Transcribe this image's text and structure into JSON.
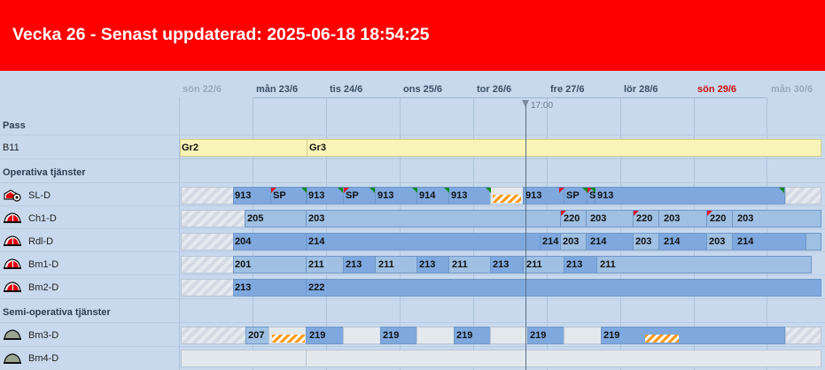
{
  "header": {
    "title": "Vecka 26 - Senast uppdaterad: 2025-06-18 18:54:25",
    "color": "#ff0000"
  },
  "days": [
    "sön 22/6",
    "mån 23/6",
    "tis 24/6",
    "ons 25/6",
    "tor 26/6",
    "fre 27/6",
    "lör 28/6",
    "sön 29/6",
    "mån 30/6"
  ],
  "now_marker": "17:00",
  "sections": {
    "pass": "Pass",
    "operativa": "Operativa tjänster",
    "semi": "Semi-operativa tjänster"
  },
  "rows": {
    "b11": "B11",
    "sl_d": "SL-D",
    "ch1_d": "Ch1-D",
    "rdl_d": "Rdl-D",
    "bm1_d": "Bm1-D",
    "bm2_d": "Bm2-D",
    "bm3_d": "Bm3-D",
    "bm4_d": "Bm4-D"
  },
  "labels": {
    "b11": [
      "Gr2",
      "Gr3"
    ],
    "sl_d": [
      "913",
      "SP",
      "913",
      "SP",
      "913",
      "914",
      "913",
      "913",
      "SP",
      "S",
      "913"
    ],
    "ch1_d": [
      "205",
      "203",
      "220",
      "203",
      "220",
      "203",
      "220",
      "203"
    ],
    "rdl_d": [
      "204",
      "214",
      "214",
      "203",
      "214",
      "203",
      "214",
      "203",
      "214"
    ],
    "bm1_d": [
      "201",
      "211",
      "213",
      "211",
      "213",
      "211",
      "213",
      "211",
      "213",
      "211"
    ],
    "bm2_d": [
      "213",
      "222"
    ],
    "bm3_d": [
      "207",
      "219",
      "219",
      "219",
      "219",
      "219"
    ]
  },
  "icons": {
    "sl_d": "fire-truck-red-icon",
    "ch1_d": "fire-helmet-red-icon",
    "rdl_d": "fire-helmet-red-icon",
    "bm1_d": "fire-helmet-red-icon",
    "bm2_d": "fire-helmet-red-icon",
    "bm3_d": "fire-helmet-grey-icon",
    "bm4_d": "fire-helmet-grey-icon"
  }
}
